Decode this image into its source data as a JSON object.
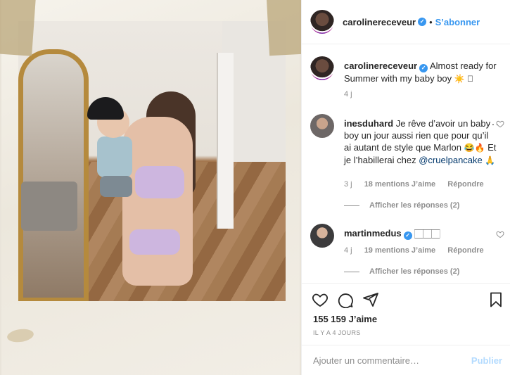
{
  "post": {
    "author": "carolinereceveur",
    "follow_label": "S’abonner",
    "separator": "•",
    "caption_text": "Almost ready for Summer with my baby boy",
    "caption_emoji": "☀️ 🏻",
    "caption_time": "4 j"
  },
  "comments": [
    {
      "username": "inesduhard",
      "text": "Je rêve d’avoir un baby boy un jour aussi rien que pour qu’il ai autant de style que Marlon",
      "emoji": "😂🔥",
      "text_after": " Et je l’habillerai chez ",
      "mention": "@cruelpancake",
      "emoji_end": "🙏",
      "time": "3 j",
      "likes": "18 mentions J’aime",
      "reply_label": "Répondre",
      "replies_label": "Afficher les réponses (2)"
    },
    {
      "username": "martinmedus",
      "text": "🏻🏻🏻",
      "time": "4 j",
      "likes": "19 mentions J’aime",
      "reply_label": "Répondre",
      "replies_label": "Afficher les réponses (2)"
    }
  ],
  "stats": {
    "likes": "155 159 J’aime",
    "timestamp": "IL Y A 4 JOURS"
  },
  "composer": {
    "placeholder": "Ajouter un commentaire…",
    "post_label": "Publier"
  },
  "colors": {
    "link_blue": "#3897f0",
    "post_disabled": "#b3dbff",
    "mention": "#00376b",
    "muted": "#8e8e8e"
  },
  "icons": {
    "like": "heart-icon",
    "comment": "comment-icon",
    "share": "paper-plane-icon",
    "save": "bookmark-icon",
    "more": "more-horizontal-icon",
    "verified": "verified-badge-icon"
  }
}
